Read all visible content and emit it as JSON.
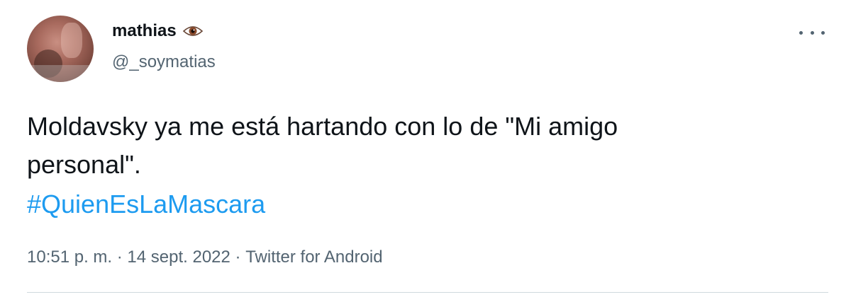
{
  "author": {
    "display_name": "mathias",
    "name_emoji_icon": "eye-icon",
    "handle": "@_soymatias"
  },
  "tweet": {
    "text": "Moldavsky ya me está hartando con lo de \"Mi amigo\npersonal\".",
    "hashtag": "#QuienEsLaMascara",
    "time": "10:51 p. m.",
    "separator": " · ",
    "date": "14 sept. 2022",
    "source": "Twitter for Android"
  },
  "colors": {
    "text": "#0f1419",
    "secondary": "#536471",
    "link": "#1d9bf0",
    "divider": "#cfd9de"
  }
}
